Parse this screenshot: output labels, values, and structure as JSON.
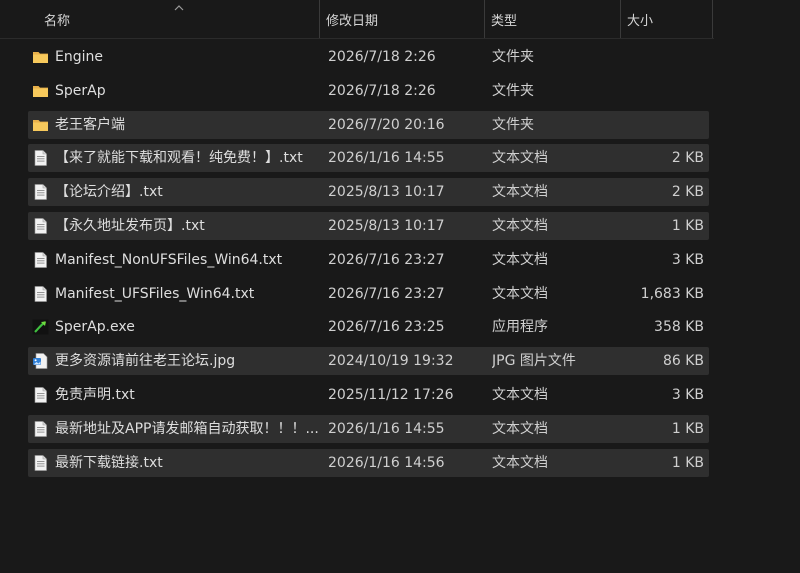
{
  "columns": {
    "name": "名称",
    "date": "修改日期",
    "type": "类型",
    "size": "大小"
  },
  "files": [
    {
      "name": "Engine",
      "date": "2026/7/18 2:26",
      "type": "文件夹",
      "size": "",
      "icon": "folder-icon",
      "selected": false
    },
    {
      "name": "SperAp",
      "date": "2026/7/18 2:26",
      "type": "文件夹",
      "size": "",
      "icon": "folder-icon",
      "selected": false
    },
    {
      "name": "老王客户端",
      "date": "2026/7/20 20:16",
      "type": "文件夹",
      "size": "",
      "icon": "folder-icon",
      "selected": true
    },
    {
      "name": "【来了就能下载和观看！纯免费！】.txt",
      "date": "2026/1/16 14:55",
      "type": "文本文档",
      "size": "2 KB",
      "icon": "text-file-icon",
      "selected": true
    },
    {
      "name": "【论坛介绍】.txt",
      "date": "2025/8/13 10:17",
      "type": "文本文档",
      "size": "2 KB",
      "icon": "text-file-icon",
      "selected": true
    },
    {
      "name": "【永久地址发布页】.txt",
      "date": "2025/8/13 10:17",
      "type": "文本文档",
      "size": "1 KB",
      "icon": "text-file-icon",
      "selected": true
    },
    {
      "name": "Manifest_NonUFSFiles_Win64.txt",
      "date": "2026/7/16 23:27",
      "type": "文本文档",
      "size": "3 KB",
      "icon": "text-file-icon",
      "selected": false
    },
    {
      "name": "Manifest_UFSFiles_Win64.txt",
      "date": "2026/7/16 23:27",
      "type": "文本文档",
      "size": "1,683 KB",
      "icon": "text-file-icon",
      "selected": false
    },
    {
      "name": "SperAp.exe",
      "date": "2026/7/16 23:25",
      "type": "应用程序",
      "size": "358 KB",
      "icon": "app-exe-icon",
      "selected": false
    },
    {
      "name": "更多资源请前往老王论坛.jpg",
      "date": "2024/10/19 19:32",
      "type": "JPG 图片文件",
      "size": "86 KB",
      "icon": "image-file-icon",
      "selected": true
    },
    {
      "name": "免责声明.txt",
      "date": "2025/11/12 17:26",
      "type": "文本文档",
      "size": "3 KB",
      "icon": "text-file-icon",
      "selected": false
    },
    {
      "name": "最新地址及APP请发邮箱自动获取！！！...",
      "date": "2026/1/16 14:55",
      "type": "文本文档",
      "size": "1 KB",
      "icon": "text-file-icon",
      "selected": true
    },
    {
      "name": "最新下载链接.txt",
      "date": "2026/1/16 14:56",
      "type": "文本文档",
      "size": "1 KB",
      "icon": "text-file-icon",
      "selected": true
    }
  ],
  "colors": {
    "background": "#191919",
    "selected_row": "#2f2f2f",
    "folder": "#f4c55b",
    "text": "#dedede"
  }
}
